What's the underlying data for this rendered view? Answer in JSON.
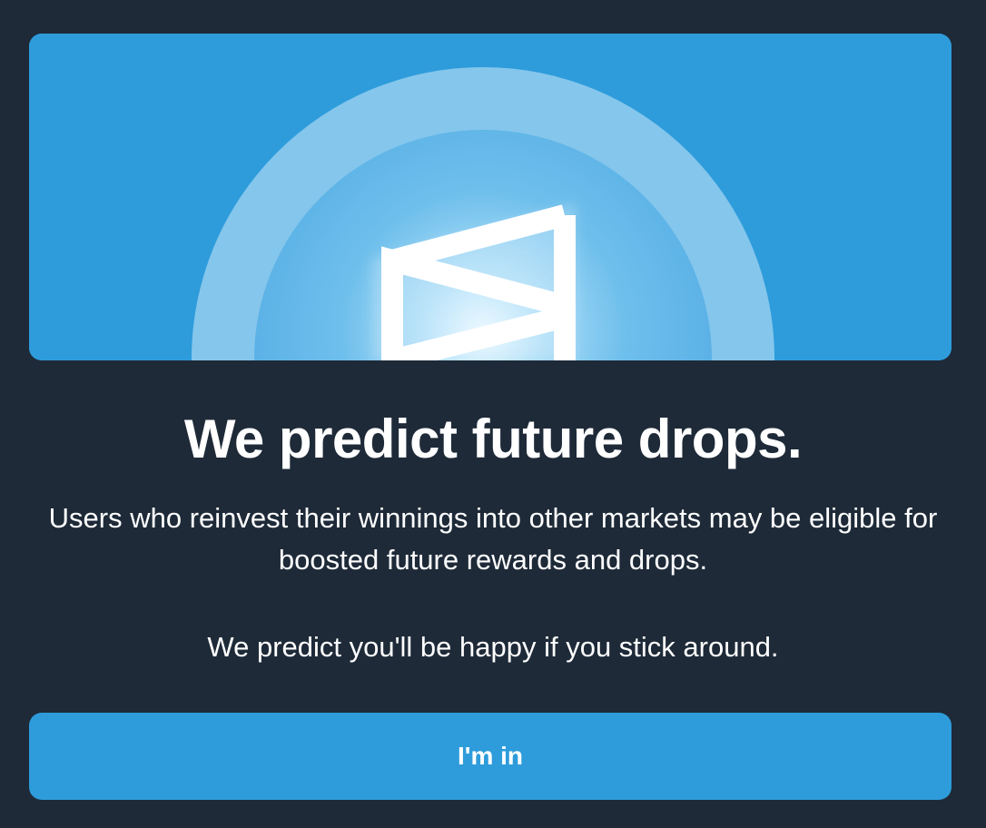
{
  "hero": {
    "logo_icon": "polymarket-logo-icon",
    "background_color": "#2e9cdb"
  },
  "title": "We predict future drops.",
  "description": "Users who reinvest their winnings into other markets may be eligible for boosted future rewards and drops.",
  "description_secondary": "We predict you'll be happy if you stick around.",
  "cta": {
    "label": "I'm in",
    "color": "#2e9cdb"
  },
  "colors": {
    "background": "#1e2a38",
    "text": "#ffffff"
  }
}
